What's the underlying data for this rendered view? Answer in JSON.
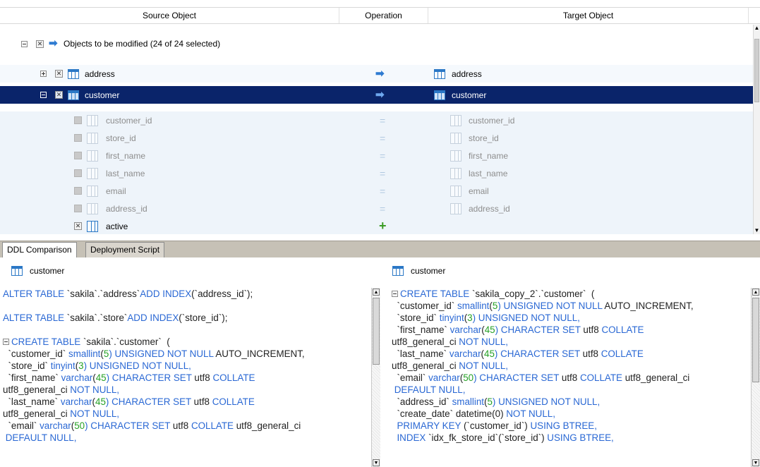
{
  "columns": {
    "source": "Source Object",
    "operation": "Operation",
    "target": "Target Object"
  },
  "group": {
    "label": "Objects to be modified (24 of 24 selected)"
  },
  "rows": {
    "address": {
      "source": "address",
      "target": "address"
    },
    "customer": {
      "source": "customer",
      "target": "customer"
    }
  },
  "customer_columns": [
    {
      "source": "customer_id",
      "target": "customer_id"
    },
    {
      "source": "store_id",
      "target": "store_id"
    },
    {
      "source": "first_name",
      "target": "first_name"
    },
    {
      "source": "last_name",
      "target": "last_name"
    },
    {
      "source": "email",
      "target": "email"
    },
    {
      "source": "address_id",
      "target": "address_id"
    }
  ],
  "added_column": {
    "source": "active"
  },
  "operation_symbols": {
    "equal": "=",
    "add": "+"
  },
  "tabs": [
    "DDL Comparison",
    "Deployment Script"
  ],
  "left_panel": {
    "title": "customer",
    "lines": [
      [
        {
          "t": "ALTER TABLE ",
          "c": "kw"
        },
        {
          "t": "`sakila`.`address`",
          "c": "blk"
        },
        {
          "t": "ADD INDEX",
          "c": "kw"
        },
        {
          "t": "(`address_id`);",
          "c": "blk"
        }
      ],
      [],
      [
        {
          "t": "ALTER TABLE ",
          "c": "kw"
        },
        {
          "t": "`sakila`.`store`",
          "c": "blk"
        },
        {
          "t": "ADD INDEX",
          "c": "kw"
        },
        {
          "t": "(`store_id`);",
          "c": "blk"
        }
      ],
      [],
      [
        {
          "t": "CREATE TABLE ",
          "c": "kw",
          "fold": true
        },
        {
          "t": "`sakila`.`customer`  (",
          "c": "blk"
        }
      ],
      [
        {
          "t": "  `customer_id` ",
          "c": "blk"
        },
        {
          "t": "smallint",
          "c": "kw"
        },
        {
          "t": "(",
          "c": "blk"
        },
        {
          "t": "5",
          "c": "num"
        },
        {
          "t": ") UNSIGNED NOT NULL ",
          "c": "kw"
        },
        {
          "t": "AUTO_INCREMENT,",
          "c": "blk"
        }
      ],
      [
        {
          "t": "  `store_id` ",
          "c": "blk"
        },
        {
          "t": "tinyint",
          "c": "kw"
        },
        {
          "t": "(",
          "c": "blk"
        },
        {
          "t": "3",
          "c": "num"
        },
        {
          "t": ") UNSIGNED NOT NULL,",
          "c": "kw"
        }
      ],
      [
        {
          "t": "  `first_name` ",
          "c": "blk"
        },
        {
          "t": "varchar",
          "c": "kw"
        },
        {
          "t": "(",
          "c": "blk"
        },
        {
          "t": "45",
          "c": "num"
        },
        {
          "t": ") CHARACTER SET ",
          "c": "kw"
        },
        {
          "t": "utf8 ",
          "c": "blk"
        },
        {
          "t": "COLLATE",
          "c": "kw"
        }
      ],
      [
        {
          "t": "utf8_general_ci ",
          "c": "blk"
        },
        {
          "t": "NOT NULL,",
          "c": "kw"
        }
      ],
      [
        {
          "t": "  `last_name` ",
          "c": "blk"
        },
        {
          "t": "varchar",
          "c": "kw"
        },
        {
          "t": "(",
          "c": "blk"
        },
        {
          "t": "45",
          "c": "num"
        },
        {
          "t": ") CHARACTER SET ",
          "c": "kw"
        },
        {
          "t": "utf8 ",
          "c": "blk"
        },
        {
          "t": "COLLATE",
          "c": "kw"
        }
      ],
      [
        {
          "t": "utf8_general_ci ",
          "c": "blk"
        },
        {
          "t": "NOT NULL,",
          "c": "kw"
        }
      ],
      [
        {
          "t": "  `email` ",
          "c": "blk"
        },
        {
          "t": "varchar",
          "c": "kw"
        },
        {
          "t": "(",
          "c": "blk"
        },
        {
          "t": "50",
          "c": "num"
        },
        {
          "t": ") CHARACTER SET ",
          "c": "kw"
        },
        {
          "t": "utf8 ",
          "c": "blk"
        },
        {
          "t": "COLLATE ",
          "c": "kw"
        },
        {
          "t": "utf8_general_ci",
          "c": "blk"
        }
      ],
      [
        {
          "t": " DEFAULT NULL,",
          "c": "kw"
        }
      ]
    ]
  },
  "right_panel": {
    "title": "customer",
    "lines": [
      [
        {
          "t": "CREATE TABLE ",
          "c": "kw",
          "fold": true
        },
        {
          "t": "`sakila_copy_2`.`customer`  (",
          "c": "blk"
        }
      ],
      [
        {
          "t": "  `customer_id` ",
          "c": "blk"
        },
        {
          "t": "smallint",
          "c": "kw"
        },
        {
          "t": "(",
          "c": "blk"
        },
        {
          "t": "5",
          "c": "num"
        },
        {
          "t": ") UNSIGNED NOT NULL ",
          "c": "kw"
        },
        {
          "t": "AUTO_INCREMENT,",
          "c": "blk"
        }
      ],
      [
        {
          "t": "  `store_id` ",
          "c": "blk"
        },
        {
          "t": "tinyint",
          "c": "kw"
        },
        {
          "t": "(",
          "c": "blk"
        },
        {
          "t": "3",
          "c": "num"
        },
        {
          "t": ") UNSIGNED NOT NULL,",
          "c": "kw"
        }
      ],
      [
        {
          "t": "  `first_name` ",
          "c": "blk"
        },
        {
          "t": "varchar",
          "c": "kw"
        },
        {
          "t": "(",
          "c": "blk"
        },
        {
          "t": "45",
          "c": "num"
        },
        {
          "t": ") CHARACTER SET ",
          "c": "kw"
        },
        {
          "t": "utf8 ",
          "c": "blk"
        },
        {
          "t": "COLLATE",
          "c": "kw"
        }
      ],
      [
        {
          "t": "utf8_general_ci ",
          "c": "blk"
        },
        {
          "t": "NOT NULL,",
          "c": "kw"
        }
      ],
      [
        {
          "t": "  `last_name` ",
          "c": "blk"
        },
        {
          "t": "varchar",
          "c": "kw"
        },
        {
          "t": "(",
          "c": "blk"
        },
        {
          "t": "45",
          "c": "num"
        },
        {
          "t": ") CHARACTER SET ",
          "c": "kw"
        },
        {
          "t": "utf8 ",
          "c": "blk"
        },
        {
          "t": "COLLATE",
          "c": "kw"
        }
      ],
      [
        {
          "t": "utf8_general_ci ",
          "c": "blk"
        },
        {
          "t": "NOT NULL,",
          "c": "kw"
        }
      ],
      [
        {
          "t": "  `email` ",
          "c": "blk"
        },
        {
          "t": "varchar",
          "c": "kw"
        },
        {
          "t": "(",
          "c": "blk"
        },
        {
          "t": "50",
          "c": "num"
        },
        {
          "t": ") CHARACTER SET ",
          "c": "kw"
        },
        {
          "t": "utf8 ",
          "c": "blk"
        },
        {
          "t": "COLLATE ",
          "c": "kw"
        },
        {
          "t": "utf8_general_ci",
          "c": "blk"
        }
      ],
      [
        {
          "t": " DEFAULT NULL,",
          "c": "kw"
        }
      ],
      [
        {
          "t": "  `address_id` ",
          "c": "blk"
        },
        {
          "t": "smallint",
          "c": "kw"
        },
        {
          "t": "(",
          "c": "blk"
        },
        {
          "t": "5",
          "c": "num"
        },
        {
          "t": ") UNSIGNED NOT NULL,",
          "c": "kw"
        }
      ],
      [
        {
          "t": "  `create_date` ",
          "c": "blk"
        },
        {
          "t": "datetime(0) ",
          "c": "blk"
        },
        {
          "t": "NOT NULL,",
          "c": "kw"
        }
      ],
      [
        {
          "t": "  PRIMARY KEY ",
          "c": "kw"
        },
        {
          "t": "(`customer_id`) ",
          "c": "blk"
        },
        {
          "t": "USING BTREE,",
          "c": "kw"
        }
      ],
      [
        {
          "t": "  INDEX ",
          "c": "kw"
        },
        {
          "t": "`idx_fk_store_id`(`store_id`) ",
          "c": "blk"
        },
        {
          "t": "USING BTREE,",
          "c": "kw"
        }
      ]
    ]
  }
}
